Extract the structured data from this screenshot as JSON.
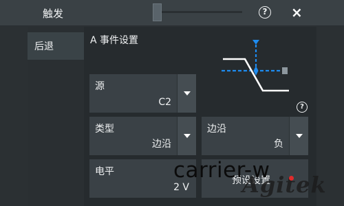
{
  "window": {
    "title": "触发"
  },
  "sidebar": {
    "items": [
      {
        "label": "后退"
      }
    ]
  },
  "section": {
    "title": "A 事件设置"
  },
  "fields": {
    "source": {
      "label": "源",
      "value": "C2"
    },
    "type": {
      "label": "类型",
      "value": "边沿"
    },
    "edge": {
      "label": "边沿",
      "value": "负"
    },
    "level": {
      "label": "电平",
      "value": "2 V"
    }
  },
  "partial_button": {
    "label": "预设设置"
  },
  "overlay": {
    "text": "carrier-w"
  },
  "watermark": {
    "text": "Agitek"
  },
  "colors": {
    "accent": "#1e8cf0",
    "panel": "#3a4146",
    "background": "#262b2e"
  },
  "icons": {
    "help": "?",
    "close": "×"
  }
}
